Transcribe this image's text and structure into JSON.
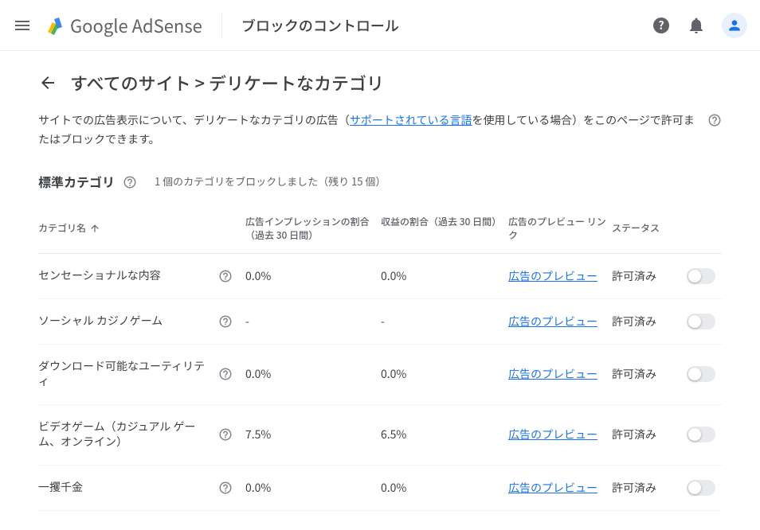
{
  "header": {
    "brand": "Google AdSense",
    "pageContext": "ブロックのコントロール"
  },
  "breadcrumb": {
    "text": "すべてのサイト > デリケートなカテゴリ"
  },
  "intro": {
    "prefix": "サイトでの広告表示について、デリケートなカテゴリの広告（",
    "linkText": "サポートされている言語",
    "suffix": "を使用している場合）をこのページで許可またはブロックできます。"
  },
  "section": {
    "title": "標準カテゴリ",
    "info": "1 個のカテゴリをブロックしました（残り 15 個）"
  },
  "columns": {
    "name": "カテゴリ名",
    "impressions": "広告インプレッションの割合（過去 30 日間）",
    "revenue": "収益の割合（過去 30 日間）",
    "preview": "広告のプレビュー リンク",
    "status": "ステータス"
  },
  "previewLinkLabel": "広告のプレビュー",
  "rows": [
    {
      "name": "センセーショナルな内容",
      "impressions": "0.0%",
      "revenue": "0.0%",
      "status": "許可済み"
    },
    {
      "name": "ソーシャル カジノゲーム",
      "impressions": "-",
      "revenue": "-",
      "status": "許可済み"
    },
    {
      "name": "ダウンロード可能なユーティリティ",
      "impressions": "0.0%",
      "revenue": "0.0%",
      "status": "許可済み"
    },
    {
      "name": "ビデオゲーム（カジュアル ゲーム、オンライン）",
      "impressions": "7.5%",
      "revenue": "6.5%",
      "status": "許可済み"
    },
    {
      "name": "一攫千金",
      "impressions": "0.0%",
      "revenue": "0.0%",
      "status": "許可済み"
    }
  ]
}
